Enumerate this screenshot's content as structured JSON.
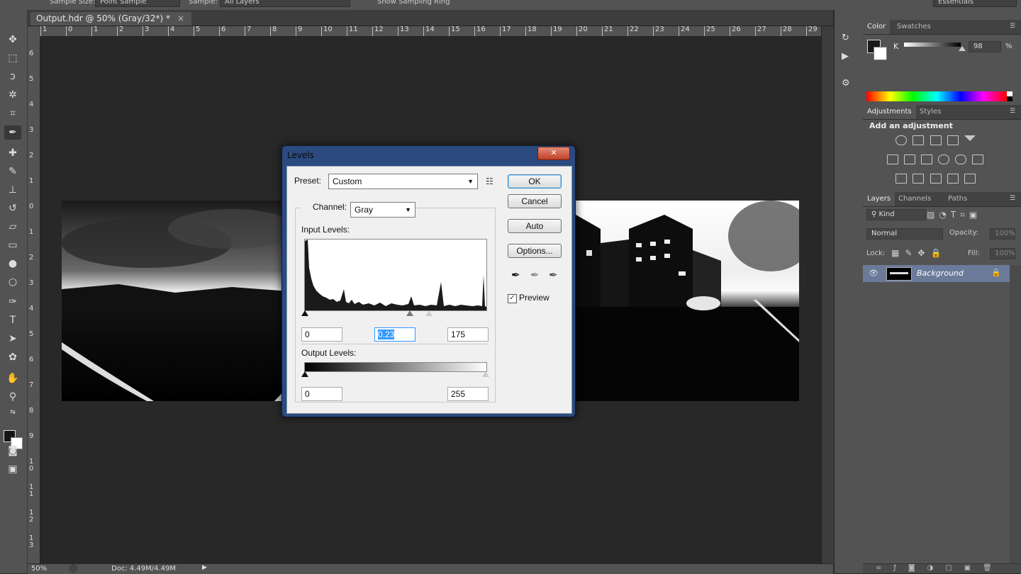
{
  "options_bar": {
    "sample_size_label": "Sample Size:",
    "sample_size_value": "Point Sample",
    "sample_label": "Sample:",
    "sample_value": "All Layers",
    "show_ring_label": "Show Sampling Ring",
    "workspace": "Essentials"
  },
  "document": {
    "tab_title": "Output.hdr @ 50% (Gray/32*) *",
    "close_glyph": "×",
    "zoom": "50%",
    "doc_info": "Doc: 4.49M/4.49M"
  },
  "rulers": {
    "horizontal": [
      "1",
      "0",
      "1",
      "2",
      "3",
      "4",
      "5",
      "6",
      "7",
      "8",
      "9",
      "10",
      "11",
      "12",
      "13",
      "14",
      "15",
      "16",
      "17",
      "18",
      "19",
      "20",
      "21",
      "22",
      "23",
      "24",
      "25",
      "26",
      "27",
      "28",
      "29"
    ],
    "vertical": [
      "6",
      "5",
      "4",
      "3",
      "2",
      "1",
      "0",
      "1",
      "2",
      "3",
      "4",
      "5",
      "6",
      "7",
      "8",
      "9",
      "1 0",
      "1 1",
      "1 2",
      "1 3"
    ]
  },
  "levels_dialog": {
    "title": "Levels",
    "close_glyph": "✕",
    "preset_label": "Preset:",
    "preset_value": "Custom",
    "channel_label": "Channel:",
    "channel_value": "Gray",
    "input_levels_label": "Input Levels:",
    "input_black": "0",
    "input_gamma": "0.23",
    "input_white": "175",
    "output_levels_label": "Output Levels:",
    "output_black": "0",
    "output_white": "255",
    "ok_label": "OK",
    "cancel_label": "Cancel",
    "auto_label": "Auto",
    "options_label": "Options...",
    "preview_label": "Preview",
    "preview_checked": true
  },
  "color_panel": {
    "tabs": [
      "Color",
      "Swatches"
    ],
    "channel": "K",
    "value": "98",
    "unit": "%"
  },
  "adjustments_panel": {
    "tabs": [
      "Adjustments",
      "Styles"
    ],
    "heading": "Add an adjustment"
  },
  "layers_panel": {
    "tabs": [
      "Layers",
      "Channels",
      "Paths"
    ],
    "filter": "Kind",
    "blend_mode": "Normal",
    "opacity_label": "Opacity:",
    "opacity_value": "100%",
    "lock_label": "Lock:",
    "fill_label": "Fill:",
    "fill_value": "100%",
    "layer_name": "Background"
  }
}
